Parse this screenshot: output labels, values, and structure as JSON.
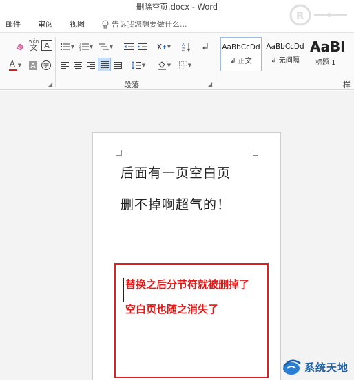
{
  "window": {
    "title": "删除空页.docx - Word"
  },
  "tabs": [
    {
      "label": "邮件"
    },
    {
      "label": "审阅"
    },
    {
      "label": "视图"
    }
  ],
  "tell_me": {
    "placeholder": "告诉我您想要做什么..."
  },
  "ribbon": {
    "font_group": {
      "clear_format_icon": "eraser-icon",
      "phonetic_label": "wén",
      "phonetic_char": "文",
      "char_border_label": "A",
      "font_color_label": "A",
      "char_shading_label": "A",
      "enclose_char_label": "字",
      "font_color": "#d92121"
    },
    "paragraph_group": {
      "label": "段落"
    },
    "styles_group": {
      "label": "样",
      "items": [
        {
          "sample": "AaBbCcDd",
          "name": "正文",
          "marker": "↲"
        },
        {
          "sample": "AaBbCcDd",
          "name": "无间隔",
          "marker": "↲"
        },
        {
          "sample": "AaBl",
          "name": "标题 1",
          "marker": ""
        }
      ]
    }
  },
  "document": {
    "lines": [
      "后面有一页空白页",
      "删不掉啊超气的！"
    ]
  },
  "annotation": {
    "lines": [
      "替换之后分节符就被删掉了",
      "空白页也随之消失了"
    ],
    "border_color": "#e02020",
    "text_color": "#e51616"
  },
  "watermark": {
    "text": "系统天地"
  }
}
